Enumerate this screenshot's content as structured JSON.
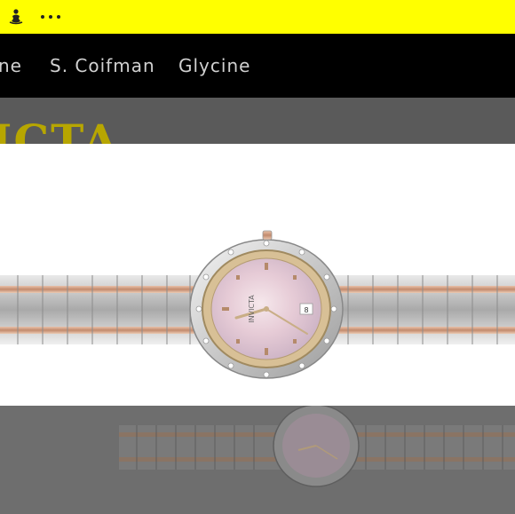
{
  "topbar": {
    "menu_icon": "meditation-figure-icon",
    "more_icon": "more-dots-icon"
  },
  "nav": {
    "items": [
      {
        "label": "ne"
      },
      {
        "label": "S. Coifman"
      },
      {
        "label": "Glycine"
      }
    ]
  },
  "brand_band": {
    "text": "ICTA"
  },
  "hero": {
    "image": "watch-image",
    "dial_brand": "INVICTA"
  },
  "colors": {
    "topbar": "#ffff00",
    "navbar": "#000000",
    "brand_text": "#b7a600"
  }
}
